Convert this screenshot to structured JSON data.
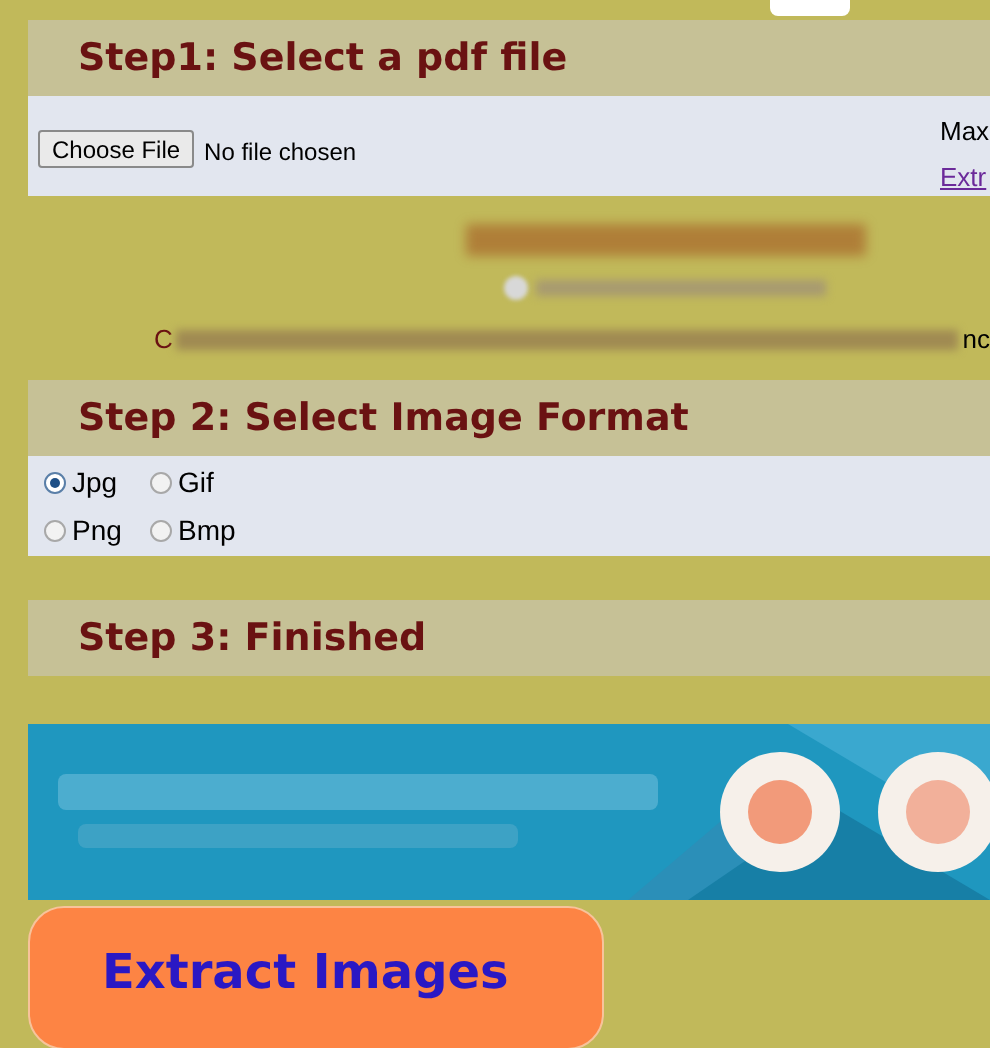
{
  "step1": {
    "title": "Step1: Select a pdf file",
    "file_button": "Choose File",
    "file_status": "No file chosen",
    "side_note": "Max",
    "side_link": "Extr"
  },
  "intro": {
    "line_start": "C",
    "line_end": "nc"
  },
  "step2": {
    "title": "Step 2: Select Image Format",
    "formats": [
      {
        "label": "Jpg",
        "selected": true
      },
      {
        "label": "Gif",
        "selected": false
      },
      {
        "label": "Png",
        "selected": false
      },
      {
        "label": "Bmp",
        "selected": false
      }
    ]
  },
  "step3": {
    "title": "Step 3: Finished"
  },
  "extract_button": "Extract Images"
}
